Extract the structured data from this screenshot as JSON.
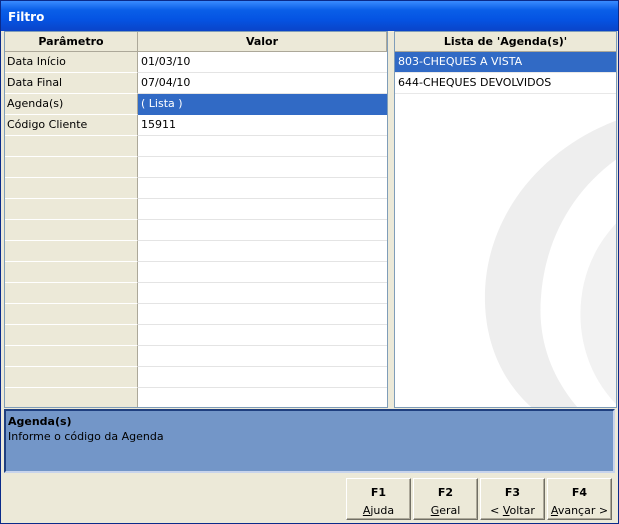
{
  "window": {
    "title": "Filtro"
  },
  "grid": {
    "columns": [
      "Parâmetro",
      "Valor"
    ],
    "rows": [
      {
        "param": "Data Início",
        "value": "01/03/10"
      },
      {
        "param": "Data Final",
        "value": "07/04/10"
      },
      {
        "param": "Agenda(s)",
        "value": "( Lista )"
      },
      {
        "param": "Código Cliente",
        "value": "15911"
      }
    ],
    "selected_row": 2
  },
  "list": {
    "header": "Lista de 'Agenda(s)'",
    "items": [
      "803-CHEQUES A VISTA",
      "644-CHEQUES DEVOLVIDOS"
    ],
    "selected_item": 0
  },
  "hint": {
    "title": "Agenda(s)",
    "description": "Informe o código da Agenda"
  },
  "buttons": [
    {
      "key": "F1",
      "label": "Ajuda",
      "mnemonic": "A"
    },
    {
      "key": "F2",
      "label": "Geral",
      "mnemonic": "G"
    },
    {
      "key": "F3",
      "label": "< Voltar",
      "mnemonic": "V"
    },
    {
      "key": "F4",
      "label": "Avançar >",
      "mnemonic": "A"
    }
  ],
  "colors": {
    "selection": "#316ac5",
    "hint_bg": "#7396c8",
    "titlebar": "#0554e3"
  }
}
